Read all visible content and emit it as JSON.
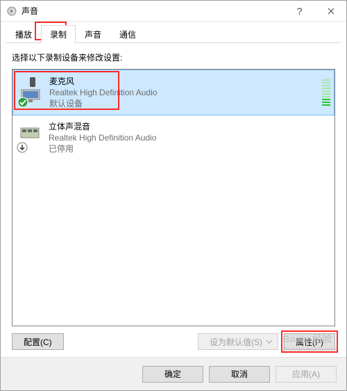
{
  "window": {
    "title": "声音"
  },
  "tabs": {
    "items": [
      "播放",
      "录制",
      "声音",
      "通信"
    ],
    "active_index": 1
  },
  "instruction": "选择以下录制设备来修改设置:",
  "devices": [
    {
      "name": "麦克风",
      "subtitle": "Realtek High Definition Audio",
      "status": "默认设备",
      "selected": true,
      "badge": "check"
    },
    {
      "name": "立体声混音",
      "subtitle": "Realtek High Definition Audio",
      "status": "已停用",
      "selected": false,
      "badge": "down"
    }
  ],
  "buttons": {
    "configure": "配置(C)",
    "set_default": "设为默认值(S)",
    "properties": "属性(P)",
    "ok": "确定",
    "cancel": "取消",
    "apply": "应用(A)"
  },
  "watermark": {
    "brand": "Baidu 经验",
    "url": "jingyan.baidu.com"
  }
}
